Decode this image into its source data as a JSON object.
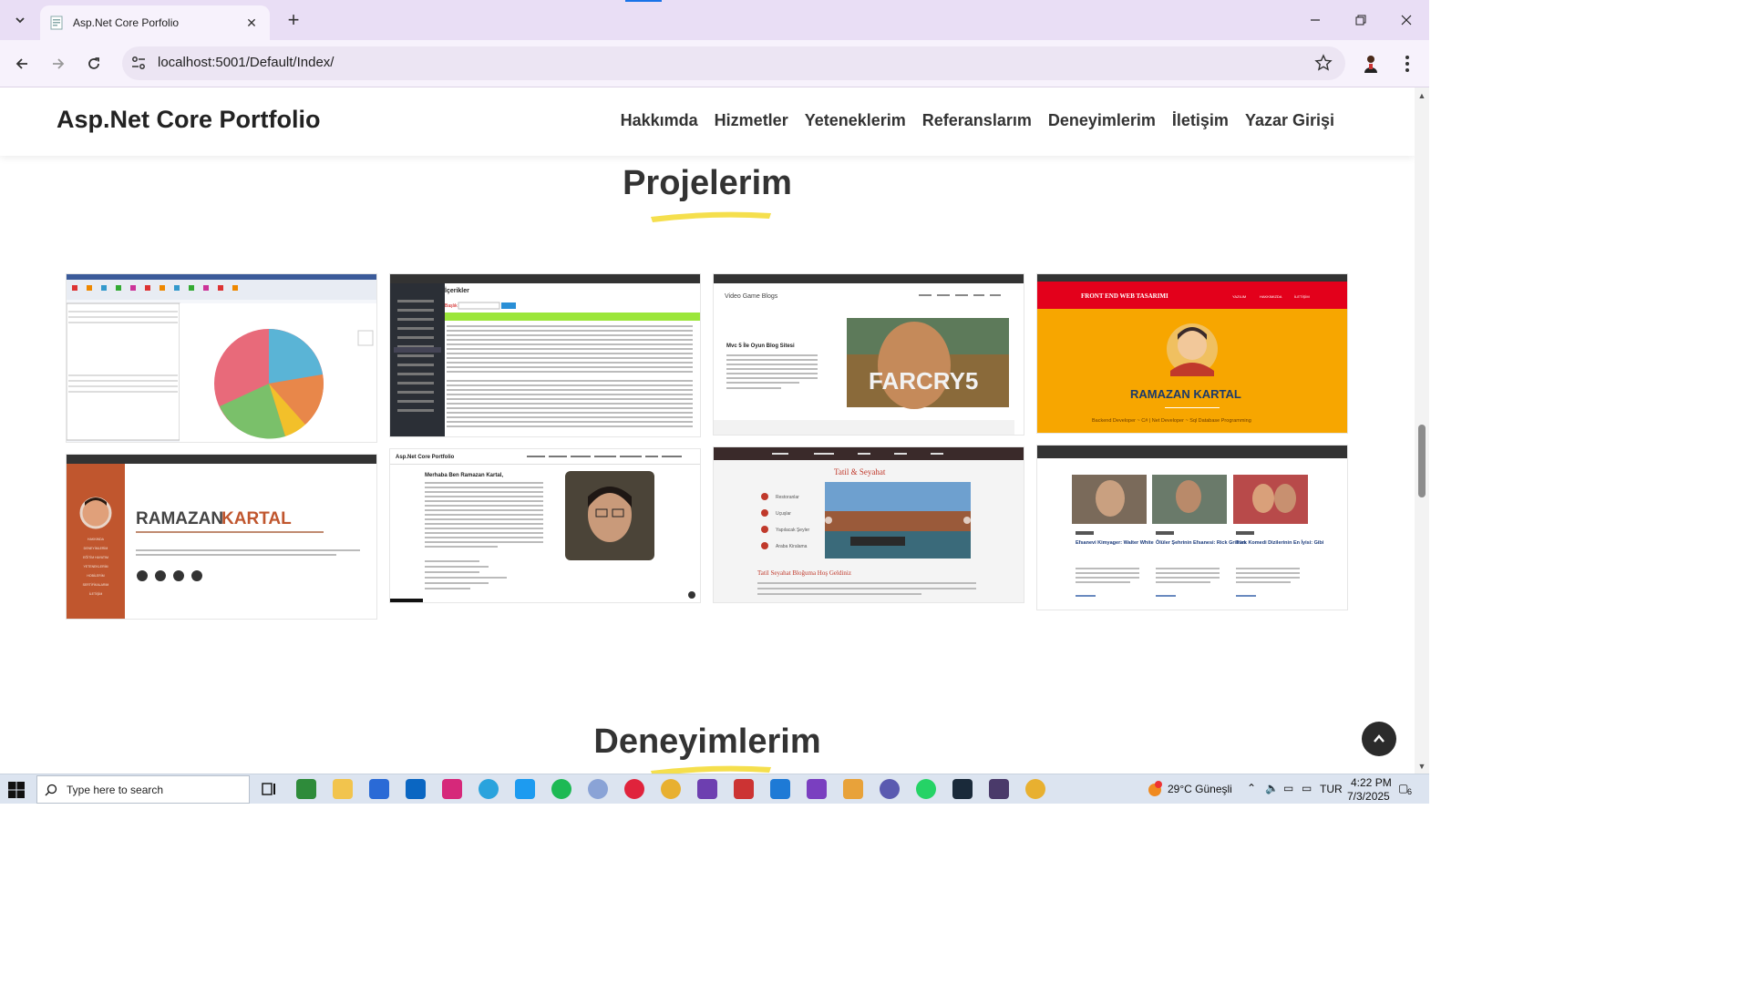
{
  "browser": {
    "tab_title": "Asp.Net Core Porfolio",
    "url": "localhost:5001/Default/Index/"
  },
  "site": {
    "brand": "Asp.Net Core Portfolio",
    "nav": [
      "Hakkımda",
      "Hizmetler",
      "Yeteneklerim",
      "Referanslarım",
      "Deneyimlerim",
      "İletişim",
      "Yazar Girişi"
    ]
  },
  "projects_section": {
    "title": "Projelerim",
    "items": [
      {
        "kind": "desktop-pie-app"
      },
      {
        "kind": "admin-panel",
        "heading": "İçerikler",
        "field_label": "Başlık"
      },
      {
        "kind": "game-blog",
        "brand": "Video Game Blogs",
        "post_title": "Mvc 5 İle Oyun Blog Sitesi",
        "image_text": "FARCRY5"
      },
      {
        "kind": "frontend",
        "header": "FRONT END WEB TASARIMI",
        "menu": [
          "YAZILIM",
          "HAKKIMIZDA",
          "İLETİŞİM"
        ],
        "name": "RAMAZAN KARTAL",
        "subtitle": "Backend Developer ~ C# | Net Developer ~ Sql Database Programming"
      },
      {
        "kind": "resume",
        "name_first": "RAMAZAN",
        "name_last": "KARTAL",
        "menu": [
          "HAKKINDA",
          "DENEYİMLERİM",
          "EĞİTİM HAYATIM",
          "YETENEKLERİM",
          "HOBİLERİM",
          "SERTİFİKALARIM",
          "İLETİŞİM"
        ]
      },
      {
        "kind": "portfolio",
        "brand": "Asp.Net Core Portfolio",
        "greeting": "Merhaba Ben Ramazan Kartal,"
      },
      {
        "kind": "travel",
        "title": "Tatil & Seyahat",
        "menu": [
          "Restoranlar",
          "Uçuşlar",
          "Yapılacak Şeyler",
          "Araba Kiralama"
        ],
        "welcome": "Tatil Seyahat Bloğuma Hoş Geldiniz"
      },
      {
        "kind": "tv-blog",
        "posts": [
          "Efsanevi Kimyager: Walter White",
          "Ölüler Şehrinin Efsanesi: Rick Grimes",
          "Türk Komedi Dizilerinin En İyisi: Gibi"
        ]
      }
    ]
  },
  "experience_section": {
    "title": "Deneyimlerim"
  },
  "taskbar": {
    "search_placeholder": "Type here to search",
    "weather": "29°C  Güneşli",
    "lang": "TUR",
    "time": "4:22 PM",
    "date": "7/3/2025",
    "notif_count": "6"
  },
  "colors": {
    "accent_yellow": "#f5df4d",
    "frontend_orange": "#f7a600",
    "frontend_red": "#e3001b",
    "resume_sidebar": "#c0562e"
  }
}
